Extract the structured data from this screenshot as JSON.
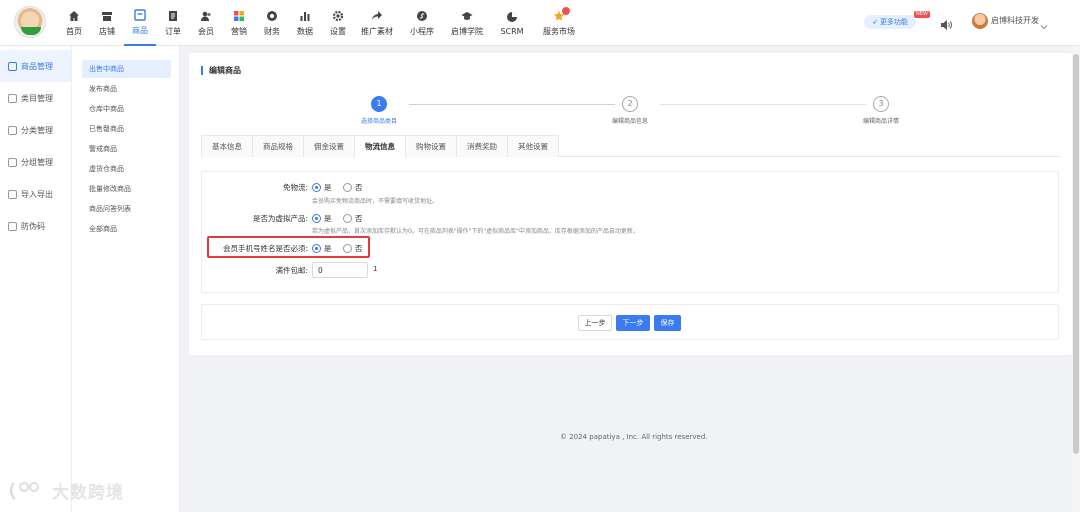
{
  "nav": {
    "items": [
      {
        "label": "首页",
        "icon": "home-icon"
      },
      {
        "label": "店铺",
        "icon": "store-icon"
      },
      {
        "label": "商品",
        "icon": "product-icon"
      },
      {
        "label": "订单",
        "icon": "order-icon"
      },
      {
        "label": "会员",
        "icon": "member-icon"
      },
      {
        "label": "营销",
        "icon": "marketing-icon"
      },
      {
        "label": "财务",
        "icon": "finance-icon"
      },
      {
        "label": "数据",
        "icon": "data-icon"
      },
      {
        "label": "设置",
        "icon": "gear-icon"
      },
      {
        "label": "推广素材",
        "icon": "share-icon"
      },
      {
        "label": "小程序",
        "icon": "miniprogram-icon"
      },
      {
        "label": "启博学院",
        "icon": "academy-icon"
      },
      {
        "label": "SCRM",
        "icon": "scrm-icon"
      },
      {
        "label": "服务市场",
        "icon": "service-market-icon"
      }
    ],
    "active_index": 2,
    "more_label": "更多功能",
    "new_tag": "NEW",
    "user_name": "启博科技开发"
  },
  "sidebar1": {
    "items": [
      {
        "label": "商品管理"
      },
      {
        "label": "类目管理"
      },
      {
        "label": "分类管理"
      },
      {
        "label": "分组管理"
      },
      {
        "label": "导入导出"
      },
      {
        "label": "防伪码"
      }
    ]
  },
  "sidebar2": {
    "items": [
      {
        "label": "出售中商品"
      },
      {
        "label": "发布商品"
      },
      {
        "label": "仓库中商品"
      },
      {
        "label": "已售罄商品"
      },
      {
        "label": "警戒商品"
      },
      {
        "label": "虚货仓商品"
      },
      {
        "label": "批量修改商品"
      },
      {
        "label": "商品问答列表"
      },
      {
        "label": "全部商品"
      }
    ]
  },
  "page": {
    "title": "编辑商品",
    "steps": [
      {
        "num": "1",
        "label": "选择商品类目"
      },
      {
        "num": "2",
        "label": "编辑商品信息"
      },
      {
        "num": "3",
        "label": "编辑商品详情"
      }
    ],
    "tabs": [
      "基本信息",
      "商品规格",
      "佣金设置",
      "物流信息",
      "购物设置",
      "消费奖励",
      "其他设置"
    ],
    "active_tab": 3,
    "form": {
      "free_shipping_label": "免物流:",
      "yes": "是",
      "no": "否",
      "free_shipping_hint": "会员购买免物流商品时，不需要填写收货地址。",
      "virtual_label": "是否为虚拟产品:",
      "virtual_hint": "若为虚拟产品，首次添加库存默认为0。可在商品列表\"操作\"下的\"虚拟商品库\"中添加商品，库存根据添加的产品自动更新。",
      "phone_required_label": "会员手机号姓名是否必须:",
      "free_ship_full_label": "满件包邮:",
      "free_ship_full_value": "0",
      "free_ship_full_suffix": "1"
    },
    "buttons": {
      "prev": "上一步",
      "next": "下一步",
      "save": "保存"
    }
  },
  "footer": "© 2024 papatiya , Inc. All rights reserved.",
  "watermark": "大数跨境",
  "colors": {
    "accent": "#3a7cf0",
    "highlight": "#e23b3b"
  }
}
